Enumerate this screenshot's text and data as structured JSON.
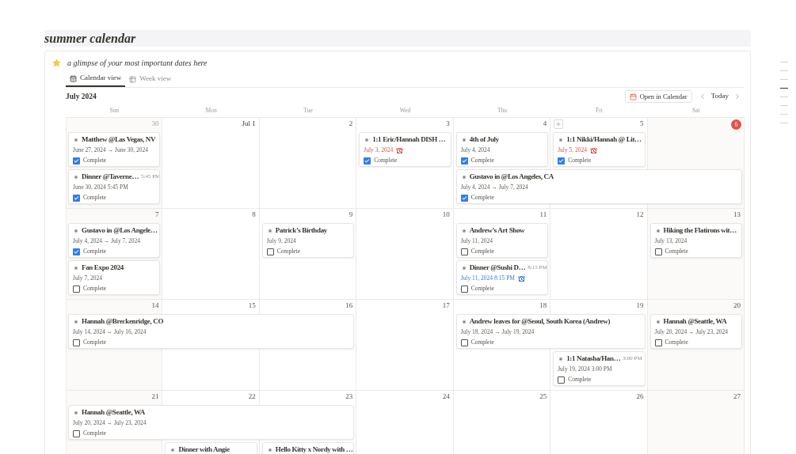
{
  "page": {
    "title": "summer calendar"
  },
  "callout": {
    "text": "a glimpse of your most important dates here"
  },
  "tabs": [
    {
      "label": "Calendar view",
      "selected": true
    },
    {
      "label": "Week view",
      "selected": false
    }
  ],
  "toolbar": {
    "month": "July 2024",
    "open_button": "Open in Calendar",
    "today_button": "Today"
  },
  "weekdays": [
    "Sun",
    "Mon",
    "Tue",
    "Wed",
    "Thu",
    "Fri",
    "Sat"
  ],
  "weeks": [
    {
      "days": [
        {
          "label": "30",
          "kind": "other"
        },
        {
          "label": "Jul 1",
          "kind": "month_start"
        },
        {
          "label": "2",
          "kind": "normal"
        },
        {
          "label": "3",
          "kind": "normal"
        },
        {
          "label": "4",
          "kind": "normal"
        },
        {
          "label": "5",
          "kind": "hover"
        },
        {
          "label": "6",
          "kind": "today"
        }
      ],
      "lanes": [
        [
          {
            "kind": "event",
            "title": "Matthew @Las Vegas, NV",
            "date": "June 27, 2024 → June 30, 2024",
            "complete_label": "Complete",
            "complete": true
          },
          {
            "kind": "empty"
          },
          {
            "kind": "empty"
          },
          {
            "kind": "event",
            "title": "1:1 Eric/Hannah DISH …",
            "date": "July 3, 2024",
            "color": "#e0534a",
            "alarm": true,
            "complete_label": "Complete",
            "complete": true
          },
          {
            "kind": "event",
            "title": "4th of July",
            "date": "July 4, 2024",
            "complete_label": "Complete",
            "complete": true
          },
          {
            "kind": "event",
            "title": "1:1 Nikki/Hannah @ Lit…",
            "date": "July 5, 2024",
            "color": "#e0534a",
            "alarm": true,
            "complete_label": "Complete",
            "complete": true
          },
          {
            "kind": "empty"
          }
        ],
        [
          {
            "kind": "event",
            "title": "Dinner @Taverne…",
            "time": "5:45 PM",
            "date": "June 30, 2024 5:45 PM",
            "complete_label": "Complete",
            "complete": true
          },
          {
            "kind": "empty"
          },
          {
            "kind": "empty"
          },
          {
            "kind": "empty"
          },
          {
            "kind": "event",
            "title": "Gustavo in @Los Angeles, CA",
            "date": "July 4, 2024 → July 7, 2024",
            "complete_label": "Complete",
            "complete": true
          },
          {
            "kind": "cont"
          },
          {
            "kind": "cont"
          }
        ]
      ]
    },
    {
      "days": [
        {
          "label": "7",
          "kind": "normal"
        },
        {
          "label": "8",
          "kind": "normal"
        },
        {
          "label": "9",
          "kind": "normal"
        },
        {
          "label": "10",
          "kind": "normal"
        },
        {
          "label": "11",
          "kind": "normal"
        },
        {
          "label": "12",
          "kind": "normal"
        },
        {
          "label": "13",
          "kind": "normal"
        }
      ],
      "lanes": [
        [
          {
            "kind": "event",
            "title": "Gustavo in @Los Angele…",
            "date": "July 4, 2024 → July 7, 2024",
            "complete_label": "Complete",
            "complete": true
          },
          {
            "kind": "empty"
          },
          {
            "kind": "event",
            "title": "Patrick’s Birthday",
            "date": "July 9, 2024",
            "complete_label": "Complete",
            "complete": false
          },
          {
            "kind": "empty"
          },
          {
            "kind": "event",
            "title": "Andrew’s Art Show",
            "date": "July 11, 2024",
            "complete_label": "Complete",
            "complete": false
          },
          {
            "kind": "empty"
          },
          {
            "kind": "event",
            "title": "Hiking the Flatirons wit…",
            "date": "July 13, 2024",
            "complete_label": "Complete",
            "complete": false
          }
        ],
        [
          {
            "kind": "event",
            "title": "Fan Expo 2024",
            "date": "July 7, 2024",
            "complete_label": "Complete",
            "complete": false
          },
          {
            "kind": "empty"
          },
          {
            "kind": "empty"
          },
          {
            "kind": "empty"
          },
          {
            "kind": "event",
            "title": "Dinner @Sushi D…",
            "time": "8:15 PM",
            "date": "July 11, 2024 8:15 PM",
            "color": "#2f80ed",
            "alarm": true,
            "complete_label": "Complete",
            "complete": false
          },
          {
            "kind": "empty"
          },
          {
            "kind": "empty"
          }
        ]
      ]
    },
    {
      "days": [
        {
          "label": "14",
          "kind": "normal"
        },
        {
          "label": "15",
          "kind": "normal"
        },
        {
          "label": "16",
          "kind": "normal"
        },
        {
          "label": "17",
          "kind": "normal"
        },
        {
          "label": "18",
          "kind": "normal"
        },
        {
          "label": "19",
          "kind": "normal"
        },
        {
          "label": "20",
          "kind": "normal"
        }
      ],
      "lanes": [
        [
          {
            "kind": "event",
            "title": "Hannah @Breckenridge, CO",
            "date": "July 14, 2024 → July 16, 2024",
            "complete_label": "Complete",
            "complete": false
          },
          {
            "kind": "cont"
          },
          {
            "kind": "cont"
          },
          {
            "kind": "empty"
          },
          {
            "kind": "event",
            "title": "Andrew leaves for @Seoul, South Korea (Andrew)",
            "date": "July 18, 2024 → July 19, 2024",
            "complete_label": "Complete",
            "complete": false
          },
          {
            "kind": "cont"
          },
          {
            "kind": "event",
            "title": "Hannah @Seattle, WA",
            "date": "July 20, 2024 → July 23, 2024",
            "complete_label": "Complete",
            "complete": false
          }
        ],
        [
          {
            "kind": "empty"
          },
          {
            "kind": "empty"
          },
          {
            "kind": "empty"
          },
          {
            "kind": "empty"
          },
          {
            "kind": "empty"
          },
          {
            "kind": "event",
            "title": "1:1 Natasha/Han…",
            "time": "3:00 PM",
            "date": "July 19, 2024 3:00 PM",
            "complete_label": "Complete",
            "complete": false
          },
          {
            "kind": "empty"
          }
        ]
      ]
    },
    {
      "days": [
        {
          "label": "21",
          "kind": "normal"
        },
        {
          "label": "22",
          "kind": "normal"
        },
        {
          "label": "23",
          "kind": "normal"
        },
        {
          "label": "24",
          "kind": "normal"
        },
        {
          "label": "25",
          "kind": "normal"
        },
        {
          "label": "26",
          "kind": "normal"
        },
        {
          "label": "27",
          "kind": "normal"
        }
      ],
      "lanes": [
        [
          {
            "kind": "event",
            "title": "Hannah @Seattle, WA",
            "date": "July 20, 2024 → July 23, 2024",
            "complete_label": "Complete",
            "complete": false
          },
          {
            "kind": "cont"
          },
          {
            "kind": "cont"
          },
          {
            "kind": "empty"
          },
          {
            "kind": "empty"
          },
          {
            "kind": "empty"
          },
          {
            "kind": "empty"
          }
        ],
        [
          {
            "kind": "empty"
          },
          {
            "kind": "event",
            "title": "Dinner with Angie"
          },
          {
            "kind": "event",
            "title": "Hello Kitty x Nordy with …"
          },
          {
            "kind": "empty"
          },
          {
            "kind": "empty"
          },
          {
            "kind": "empty"
          },
          {
            "kind": "empty"
          }
        ]
      ]
    }
  ]
}
